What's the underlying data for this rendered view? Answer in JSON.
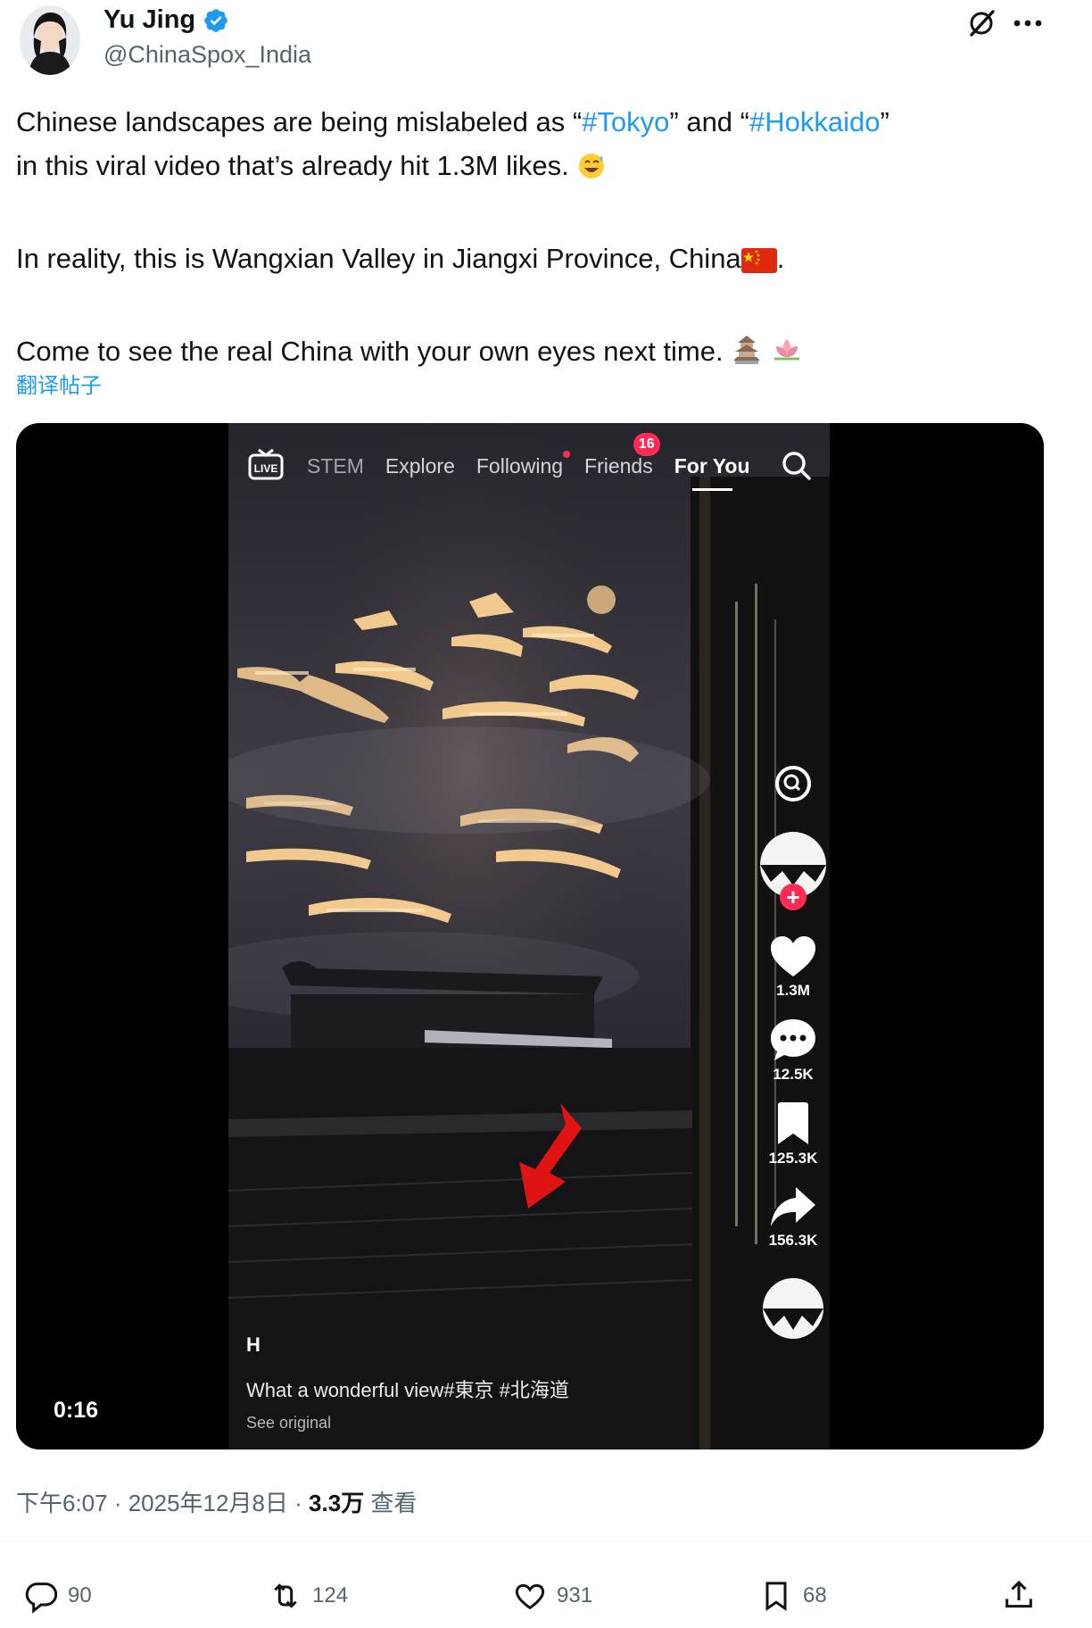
{
  "author": {
    "name": "Yu Jing",
    "handle": "@ChinaSpox_India",
    "verified": true
  },
  "tweet": {
    "line1_pre": "Chinese landscapes are being mislabeled as “",
    "tag1": "#Tokyo",
    "line1_mid": "” and “",
    "tag2": "#Hokkaido",
    "line1_post": "”",
    "line2": "in this viral video that’s already hit 1.3M likes.",
    "line3": "In reality, this is Wangxian Valley in Jiangxi Province, China",
    "line3_end": ".",
    "line4": "Come to see the real China with your own eyes next time.",
    "translate": "翻译帖子"
  },
  "video": {
    "duration": "0:16",
    "nav": {
      "stem": "STEM",
      "explore": "Explore",
      "following": "Following",
      "friends": "Friends",
      "friends_badge": "16",
      "for_you": "For You"
    },
    "side": {
      "likes": "1.3M",
      "comments": "12.5K",
      "saves": "125.3K",
      "shares": "156.3K"
    },
    "caption": {
      "user": "H",
      "text": "What a wonderful view#東京 #北海道",
      "see_original": "See original"
    }
  },
  "meta": {
    "time": "下午6:07 · 2025年12月8日 · ",
    "views": "3.3万",
    "views_label": " 查看"
  },
  "actions": {
    "replies": "90",
    "reposts": "124",
    "likes": "931",
    "bookmarks": "68"
  },
  "colors": {
    "link": "#1d9bf0",
    "text": "#0f1419",
    "muted": "#536471",
    "tiktok_red": "#fe2c55"
  }
}
